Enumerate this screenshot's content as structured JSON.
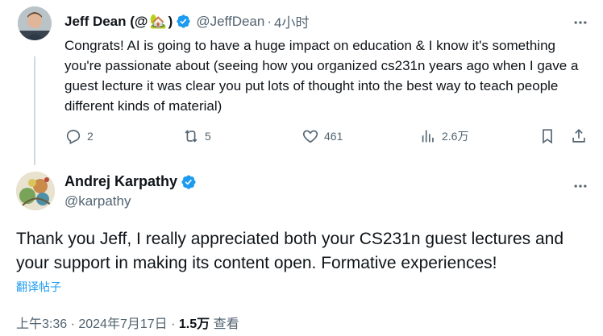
{
  "reply_tweet": {
    "display_name": "Jeff Dean (@",
    "name_suffix": ")",
    "emoji": "🏡",
    "handle": "@JeffDean",
    "separator": "·",
    "time": "4小时",
    "text": "Congrats! AI is going to have a huge impact on education & I know it's something you're passionate about (seeing how you organized cs231n years ago when I gave a guest lecture it was clear you put lots of thought into the best way to teach people different kinds of material)",
    "reply_count": "2",
    "retweet_count": "5",
    "like_count": "461",
    "view_count": "2.6万"
  },
  "main_tweet": {
    "display_name": "Andrej Karpathy",
    "handle": "@karpathy",
    "text": "Thank you Jeff, I really appreciated both your CS231n guest lectures and your support in making its content open. Formative experiences!",
    "translate_label": "翻译帖子",
    "timestamp": "上午3:36 · 2024年7月17日 · ",
    "views_value": "1.5万",
    "views_label": " 查看"
  },
  "colors": {
    "verified": "#1d9bf0",
    "secondary_text": "#536471",
    "link": "#1d9bf0"
  }
}
